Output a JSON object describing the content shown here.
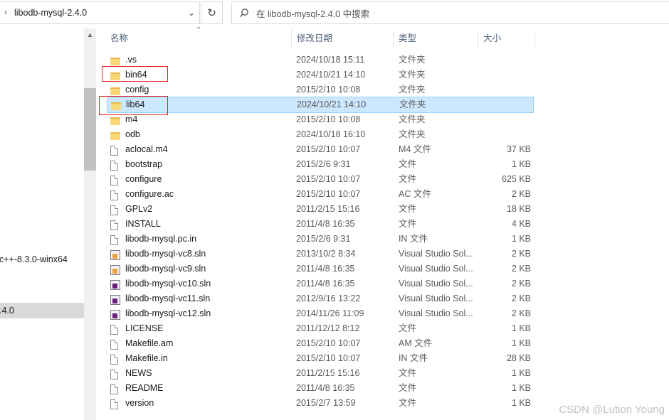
{
  "address": {
    "path": "libodb-mysql-2.4.0",
    "chevron_icon": "chevron-right-icon",
    "dropdown_icon": "chevron-down-icon",
    "refresh_icon": "refresh-icon"
  },
  "search": {
    "placeholder": "在 libodb-mysql-2.4.0 中搜索",
    "icon": "search-icon"
  },
  "nav": {
    "items": [
      {
        "label": "c++-8.3.0-winx64",
        "selected": false
      },
      {
        "label": ".4.0",
        "selected": true
      }
    ]
  },
  "columns": {
    "name": "名称",
    "date": "修改日期",
    "type": "类型",
    "size": "大小"
  },
  "files": [
    {
      "name": ".vs",
      "date": "2024/10/18 15:11",
      "type": "文件夹",
      "size": "",
      "icon": "folder-icon",
      "selected": false
    },
    {
      "name": "bin64",
      "date": "2024/10/21 14:10",
      "type": "文件夹",
      "size": "",
      "icon": "folder-icon",
      "selected": false
    },
    {
      "name": "config",
      "date": "2015/2/10 10:08",
      "type": "文件夹",
      "size": "",
      "icon": "folder-icon",
      "selected": false
    },
    {
      "name": "lib64",
      "date": "2024/10/21 14:10",
      "type": "文件夹",
      "size": "",
      "icon": "folder-icon",
      "selected": true
    },
    {
      "name": "m4",
      "date": "2015/2/10 10:08",
      "type": "文件夹",
      "size": "",
      "icon": "folder-icon",
      "selected": false
    },
    {
      "name": "odb",
      "date": "2024/10/18 16:10",
      "type": "文件夹",
      "size": "",
      "icon": "folder-icon",
      "selected": false
    },
    {
      "name": "aclocal.m4",
      "date": "2015/2/10 10:07",
      "type": "M4 文件",
      "size": "37 KB",
      "icon": "file-icon",
      "selected": false
    },
    {
      "name": "bootstrap",
      "date": "2015/2/6 9:31",
      "type": "文件",
      "size": "1 KB",
      "icon": "file-icon",
      "selected": false
    },
    {
      "name": "configure",
      "date": "2015/2/10 10:07",
      "type": "文件",
      "size": "625 KB",
      "icon": "file-icon",
      "selected": false
    },
    {
      "name": "configure.ac",
      "date": "2015/2/10 10:07",
      "type": "AC 文件",
      "size": "2 KB",
      "icon": "file-icon",
      "selected": false
    },
    {
      "name": "GPLv2",
      "date": "2011/2/15 15:16",
      "type": "文件",
      "size": "18 KB",
      "icon": "file-icon",
      "selected": false
    },
    {
      "name": "INSTALL",
      "date": "2011/4/8 16:35",
      "type": "文件",
      "size": "4 KB",
      "icon": "file-icon",
      "selected": false
    },
    {
      "name": "libodb-mysql.pc.in",
      "date": "2015/2/6 9:31",
      "type": "IN 文件",
      "size": "1 KB",
      "icon": "file-icon",
      "selected": false
    },
    {
      "name": "libodb-mysql-vc8.sln",
      "date": "2013/10/2 8:34",
      "type": "Visual Studio Sol...",
      "size": "2 KB",
      "icon": "sln-old-icon",
      "selected": false
    },
    {
      "name": "libodb-mysql-vc9.sln",
      "date": "2011/4/8 16:35",
      "type": "Visual Studio Sol...",
      "size": "2 KB",
      "icon": "sln-old-icon",
      "selected": false
    },
    {
      "name": "libodb-mysql-vc10.sln",
      "date": "2011/4/8 16:35",
      "type": "Visual Studio Sol...",
      "size": "2 KB",
      "icon": "sln-icon",
      "selected": false
    },
    {
      "name": "libodb-mysql-vc11.sln",
      "date": "2012/9/16 13:22",
      "type": "Visual Studio Sol...",
      "size": "2 KB",
      "icon": "sln-icon",
      "selected": false
    },
    {
      "name": "libodb-mysql-vc12.sln",
      "date": "2014/11/26 11:09",
      "type": "Visual Studio Sol...",
      "size": "2 KB",
      "icon": "sln-icon",
      "selected": false
    },
    {
      "name": "LICENSE",
      "date": "2011/12/12 8:12",
      "type": "文件",
      "size": "1 KB",
      "icon": "file-icon",
      "selected": false
    },
    {
      "name": "Makefile.am",
      "date": "2015/2/10 10:07",
      "type": "AM 文件",
      "size": "1 KB",
      "icon": "file-icon",
      "selected": false
    },
    {
      "name": "Makefile.in",
      "date": "2015/2/10 10:07",
      "type": "IN 文件",
      "size": "28 KB",
      "icon": "file-icon",
      "selected": false
    },
    {
      "name": "NEWS",
      "date": "2011/2/15 15:16",
      "type": "文件",
      "size": "1 KB",
      "icon": "file-icon",
      "selected": false
    },
    {
      "name": "README",
      "date": "2011/4/8 16:35",
      "type": "文件",
      "size": "1 KB",
      "icon": "file-icon",
      "selected": false
    },
    {
      "name": "version",
      "date": "2015/2/7 13:59",
      "type": "文件",
      "size": "1 KB",
      "icon": "file-icon",
      "selected": false
    }
  ],
  "highlights": [
    "bin64",
    "lib64"
  ],
  "colors": {
    "selection_bg": "#cce8ff",
    "selection_border": "#99d1ff",
    "highlight_box": "#e32424",
    "folder": "#f8d775"
  },
  "watermark": "CSDN @Lution Young"
}
